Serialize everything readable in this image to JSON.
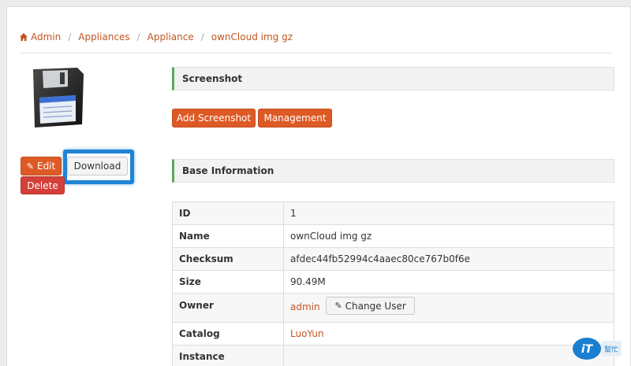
{
  "breadcrumb": {
    "home_icon": "home-icon",
    "items": [
      "Admin",
      "Appliances",
      "Appliance",
      "ownCloud img gz"
    ]
  },
  "image_icon": "floppy-disk-icon",
  "actions": {
    "edit_label": "Edit",
    "edit_icon": "edit-icon",
    "download_label": "Download",
    "delete_label": "Delete"
  },
  "screenshot_section": {
    "title": "Screenshot",
    "add_label": "Add Screenshot",
    "management_label": "Management"
  },
  "base_info": {
    "title": "Base Information",
    "rows": [
      {
        "label": "ID",
        "value": "1"
      },
      {
        "label": "Name",
        "value": "ownCloud img gz"
      },
      {
        "label": "Checksum",
        "value": "afdec44fb52994c4aaec80ce767b0f6e"
      },
      {
        "label": "Size",
        "value": "90.49M"
      },
      {
        "label": "Owner",
        "value": "admin",
        "button": "Change User"
      },
      {
        "label": "Catalog",
        "value": "LuoYun"
      },
      {
        "label": "Instance",
        "value": ""
      }
    ]
  },
  "colors": {
    "accent": "#dd5a26",
    "danger": "#d43f3a",
    "highlight": "#1f83d6",
    "link": "#c0561f"
  }
}
